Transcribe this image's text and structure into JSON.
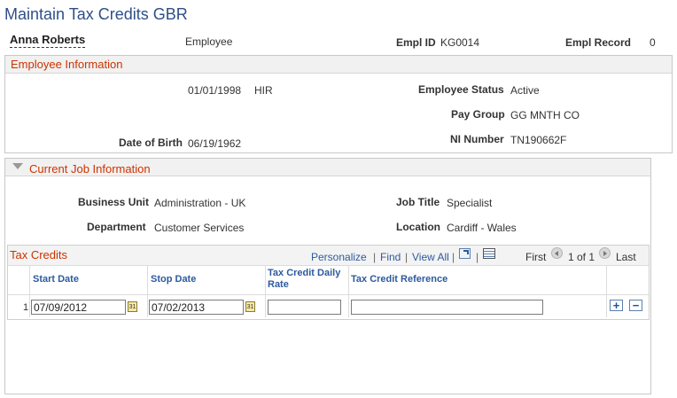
{
  "page": {
    "title": "Maintain Tax Credits GBR"
  },
  "employee": {
    "name": "Anna Roberts",
    "type": "Employee",
    "empl_id_label": "Empl ID",
    "empl_id": "KG0014",
    "empl_record_label": "Empl Record",
    "empl_record": "0"
  },
  "employee_info": {
    "title": "Employee Information",
    "hire_date": "01/01/1998",
    "action": "HIR",
    "status_label": "Employee Status",
    "status": "Active",
    "pay_group_label": "Pay Group",
    "pay_group": "GG MNTH CO",
    "dob_label": "Date of Birth",
    "dob": "06/19/1962",
    "ni_label": "NI Number",
    "ni": "TN190662F"
  },
  "job_info": {
    "title": "Current Job Information",
    "business_unit_label": "Business Unit",
    "business_unit": "Administration - UK",
    "job_title_label": "Job Title",
    "job_title": "Specialist",
    "department_label": "Department",
    "department": "Customer Services",
    "location_label": "Location",
    "location": "Cardiff - Wales"
  },
  "tax_credits": {
    "title": "Tax Credits",
    "personalize": "Personalize",
    "find": "Find",
    "view_all": "View All",
    "sep": "|",
    "first": "First",
    "range": "1 of 1",
    "last": "Last",
    "columns": {
      "start_date": "Start Date",
      "stop_date": "Stop Date",
      "daily_rate": "Tax Credit Daily Rate",
      "reference": "Tax Credit Reference"
    },
    "rows": [
      {
        "num": "1",
        "start_date": "07/09/2012",
        "stop_date": "07/02/2013",
        "daily_rate": "",
        "reference": ""
      }
    ]
  },
  "icons": {
    "calendar": "calendar-icon",
    "add": "plus",
    "remove": "minus",
    "zoom": "zoom-grid-icon",
    "download": "download-spreadsheet-icon"
  }
}
